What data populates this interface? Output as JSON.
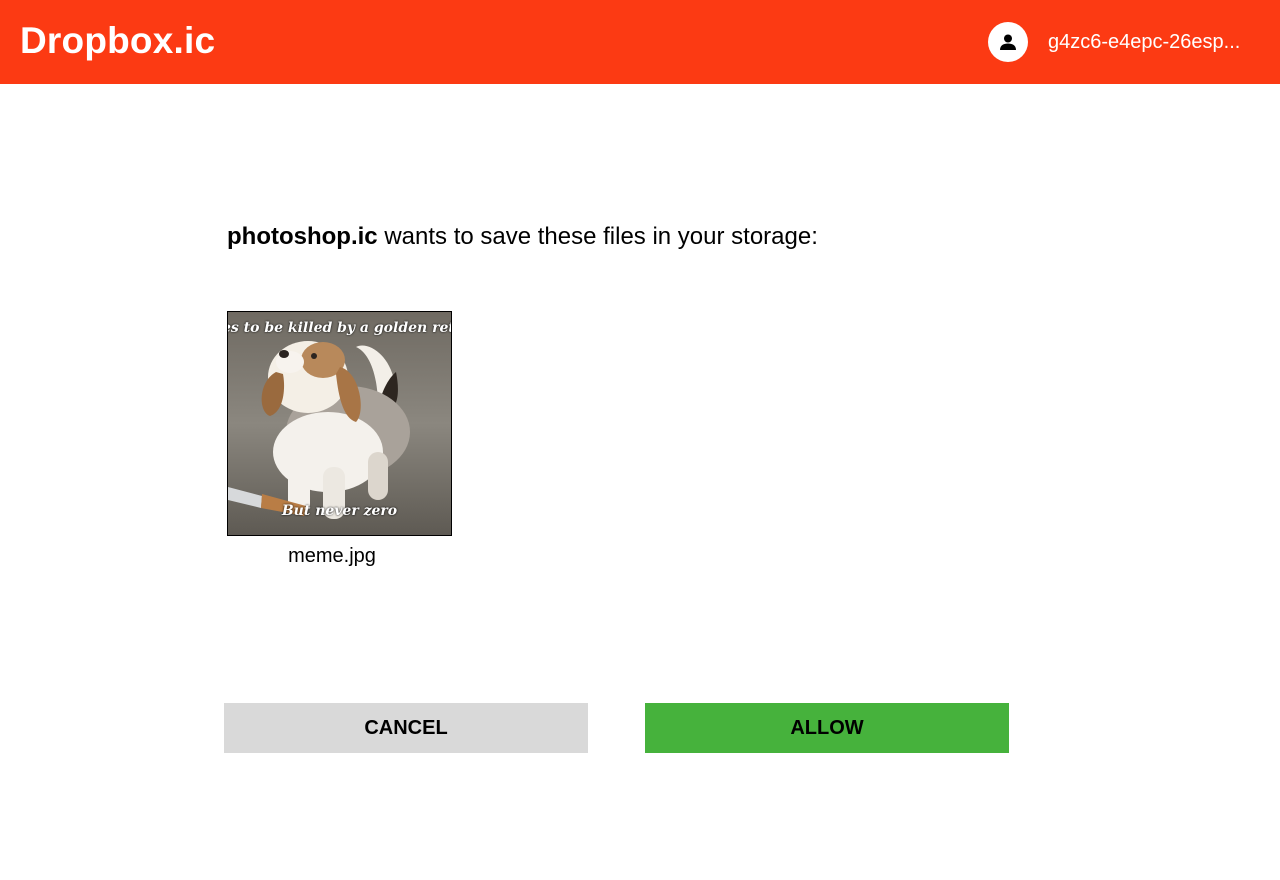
{
  "header": {
    "brand": "Dropbox.ic",
    "username": "g4zc6-e4epc-26esp...",
    "avatar_icon": "person-icon",
    "background_color": "#fc3a13"
  },
  "dialog": {
    "app_name": "photoshop.ic",
    "message": " wants to save these files in your storage:",
    "files": [
      {
        "name": "meme.jpg",
        "meme_top_text": "es to be killed by a golden retriever a",
        "meme_bottom_text": "But never zero"
      }
    ]
  },
  "actions": {
    "cancel_label": "CANCEL",
    "allow_label": "ALLOW",
    "cancel_color": "#d9d9d9",
    "allow_color": "#46b23c"
  }
}
